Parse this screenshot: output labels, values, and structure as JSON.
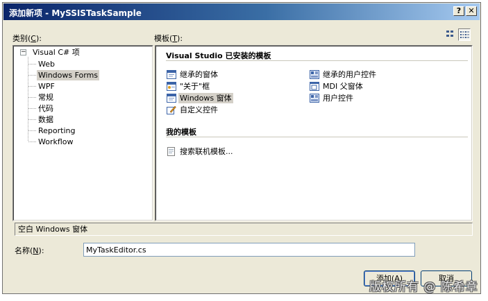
{
  "window": {
    "title": "添加新项 - MySSISTaskSample",
    "help_button": "?",
    "close_button": "✕"
  },
  "categories": {
    "label_prefix": "类别(",
    "label_key": "C",
    "label_suffix": "):",
    "root": "Visual C# 项",
    "collapse_glyph": "−",
    "items": [
      {
        "label": "Web"
      },
      {
        "label": "Windows Forms",
        "selected": true
      },
      {
        "label": "WPF"
      },
      {
        "label": "常规"
      },
      {
        "label": "代码"
      },
      {
        "label": "数据"
      },
      {
        "label": "Reporting"
      },
      {
        "label": "Workflow"
      }
    ]
  },
  "templates": {
    "label_prefix": "模板(",
    "label_key": "T",
    "label_suffix": "):",
    "installed_header": "Visual Studio 已安装的模板",
    "installed_left": [
      {
        "label": "继承的窗体",
        "icon": "form-icon"
      },
      {
        "label": "\"关于\"框",
        "icon": "about-box-icon"
      },
      {
        "label": "Windows 窗体",
        "icon": "form-icon",
        "selected": true
      },
      {
        "label": "自定义控件",
        "icon": "custom-control-icon"
      }
    ],
    "installed_right": [
      {
        "label": "继承的用户控件",
        "icon": "user-control-icon"
      },
      {
        "label": "MDI 父窗体",
        "icon": "mdi-form-icon"
      },
      {
        "label": "用户控件",
        "icon": "user-control-icon"
      }
    ],
    "my_header": "我的模板",
    "my_items": [
      {
        "label": "搜索联机模板...",
        "icon": "search-online-icon"
      }
    ]
  },
  "description": "空白 Windows 窗体",
  "name_field": {
    "label_prefix": "名称(",
    "label_key": "N",
    "label_suffix": "):",
    "value": "MyTaskEditor.cs"
  },
  "buttons": {
    "add_prefix": "添加(",
    "add_key": "A",
    "add_suffix": ")",
    "cancel": "取消"
  },
  "watermark": "版权所有 @ 陈希章",
  "colors": {
    "title_gradient_start": "#0a246a",
    "title_gradient_end": "#a6caf0",
    "dialog_face": "#ece9d8",
    "selection": "#d4d0c8"
  }
}
